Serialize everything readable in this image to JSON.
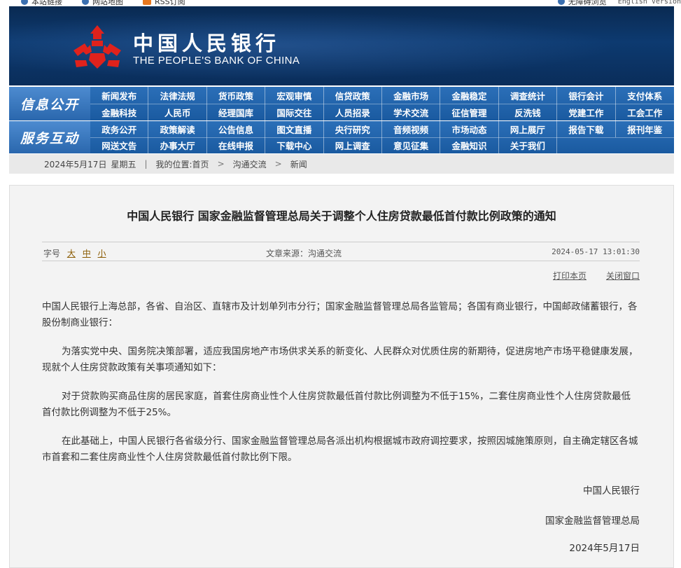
{
  "topbar": {
    "left": [
      "本站链接",
      "网站地图",
      "RSS订阅"
    ],
    "right": [
      "无障碍浏览",
      "English Version"
    ]
  },
  "banner": {
    "title_cn": "中国人民银行",
    "title_en": "THE PEOPLE'S BANK OF CHINA"
  },
  "nav": {
    "section1_label": "信息公开",
    "section1_items": [
      "新闻发布",
      "法律法规",
      "货币政策",
      "宏观审慎",
      "信贷政策",
      "金融市场",
      "金融稳定",
      "调查统计",
      "银行会计",
      "支付体系",
      "金融科技",
      "人民币",
      "经理国库",
      "国际交往",
      "人员招录",
      "学术交流",
      "征信管理",
      "反洗钱",
      "党建工作",
      "工会工作"
    ],
    "section2_label": "服务互动",
    "section2_items": [
      "政务公开",
      "政策解读",
      "公告信息",
      "图文直播",
      "央行研究",
      "音频视频",
      "市场动态",
      "网上展厅",
      "报告下载",
      "报刊年鉴",
      "网送文告",
      "办事大厅",
      "在线申报",
      "下载中心",
      "网上调查",
      "意见征集",
      "金融知识",
      "关于我们"
    ]
  },
  "breadcrumb": {
    "date": "2024年5月17日",
    "weekday": "星期五",
    "location_label": "我的位置:首页",
    "level1": "沟通交流",
    "level2": "新闻"
  },
  "article": {
    "title": "中国人民银行  国家金融监督管理总局关于调整个人住房贷款最低首付款比例政策的通知",
    "font_size_label": "字号",
    "font_large": "大",
    "font_medium": "中",
    "font_small": "小",
    "source": "文章来源：沟通交流",
    "datetime": "2024-05-17  13:01:30",
    "print_label": "打印本页",
    "close_label": "关闭窗口",
    "paragraphs": [
      "中国人民银行上海总部，各省、自治区、直辖市及计划单列市分行；国家金融监督管理总局各监管局；各国有商业银行，中国邮政储蓄银行，各股份制商业银行：",
      "为落实党中央、国务院决策部署，适应我国房地产市场供求关系的新变化、人民群众对优质住房的新期待，促进房地产市场平稳健康发展，现就个人住房贷款政策有关事项通知如下：",
      "对于贷款购买商品住房的居民家庭，首套住房商业性个人住房贷款最低首付款比例调整为不低于15%，二套住房商业性个人住房贷款最低首付款比例调整为不低于25%。",
      "在此基础上，中国人民银行各省级分行、国家金融监督管理总局各派出机构根据城市政府调控要求，按照因城施策原则，自主确定辖区各城市首套和二套住房商业性个人住房贷款最低首付款比例下限。"
    ],
    "signers": [
      "中国人民银行",
      "国家金融监督管理总局"
    ],
    "sign_date": "2024年5月17日"
  }
}
